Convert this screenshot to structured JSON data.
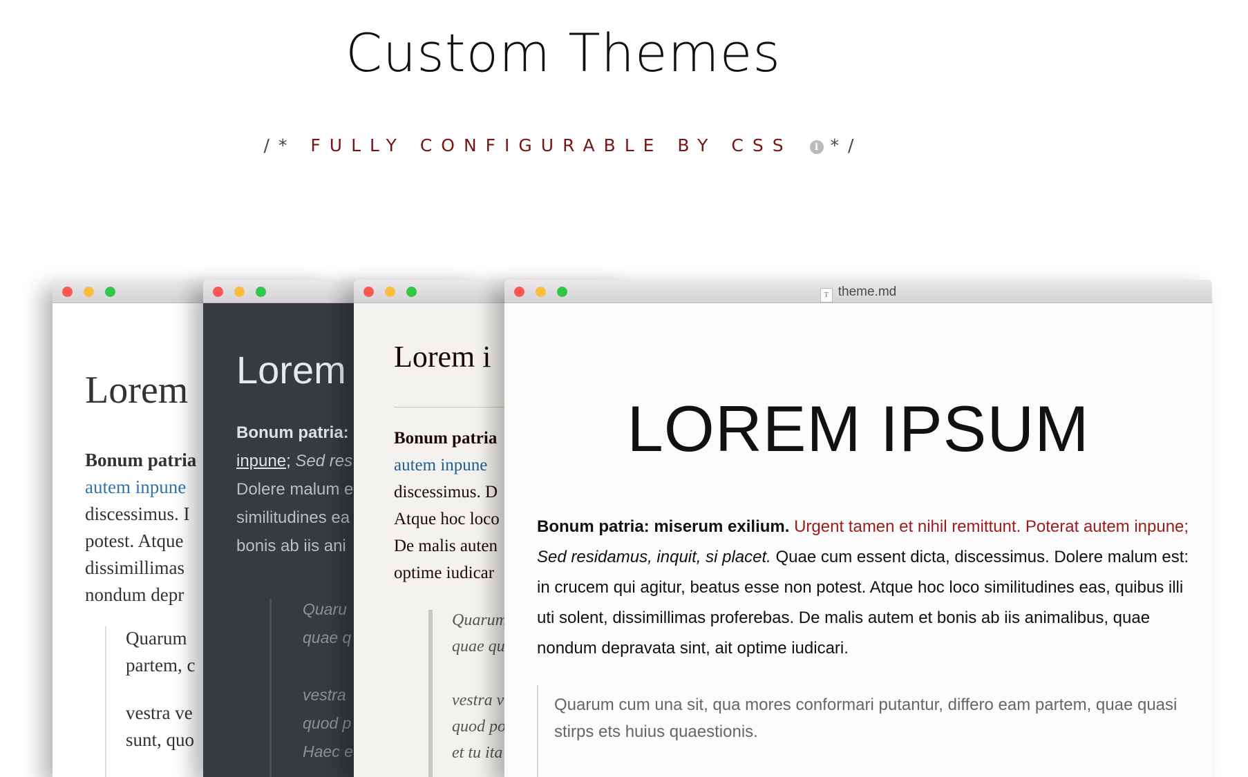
{
  "header": {
    "title": "Custom Themes",
    "subtitle_open": "/*",
    "subtitle_highlight": "FULLY CONFIGURABLE BY CSS",
    "subtitle_close": "*/",
    "info_icon": "info-icon"
  },
  "windows": [
    {
      "theme_bg": "#ffffff",
      "heading": "Lorem",
      "bold": "Bonum patria",
      "link": "autem inpune",
      "lines": [
        "discessimus. I",
        "potest. Atque",
        "dissimillimas",
        "nondum depr"
      ],
      "quote_lines": [
        "Quarum",
        "partem, c",
        "vestra ve",
        "sunt, quo"
      ]
    },
    {
      "theme_bg": "#363b40",
      "heading": "Lorem",
      "bold": "Bonum patria:",
      "link": "inpune",
      "italic": "Sed res",
      "lines": [
        "Dolere malum e",
        "similitudines ea",
        "bonis ab iis ani"
      ],
      "quote_lines": [
        "Quaru",
        "quae q",
        "vestra",
        "quod p",
        "Haec e"
      ]
    },
    {
      "theme_bg": "#f3f2ee",
      "heading": "Lorem i",
      "bold": "Bonum patria",
      "link": "autem inpune",
      "lines": [
        "discessimus. D",
        "Atque hoc loco",
        "De malis auten",
        "optime iudicar"
      ],
      "quote_lines": [
        "Quarum",
        "quae qu",
        "vestra v",
        "quod po",
        "et tu ita"
      ]
    },
    {
      "title": "theme.md",
      "title_icon": "T",
      "heading": "LOREM IPSUM",
      "para_bold": "Bonum patria: miserum exilium.",
      "para_red": "Urgent tamen et nihil remittunt. Poterat autem inpune;",
      "para_italic": "Sed residamus, inquit, si placet.",
      "para_rest": "Quae cum essent dicta, discessimus. Dolere malum est: in crucem qui agitur, beatus esse non potest. Atque hoc loco similitudines eas, quibus illi uti solent, dissimillimas proferebas. De malis autem et bonis ab iis animalibus, quae nondum depravata sint, ait optime iudicari.",
      "quote": "Quarum cum una sit, qua mores conformari putantur, differo eam partem, quae quasi stirps ets huius quaestionis."
    }
  ],
  "colors": {
    "accent_red": "#9b1b1b",
    "link_blue": "#2f73ad",
    "traffic_red": "#fc5753",
    "traffic_yellow": "#fdbc40",
    "traffic_green": "#33c748"
  }
}
